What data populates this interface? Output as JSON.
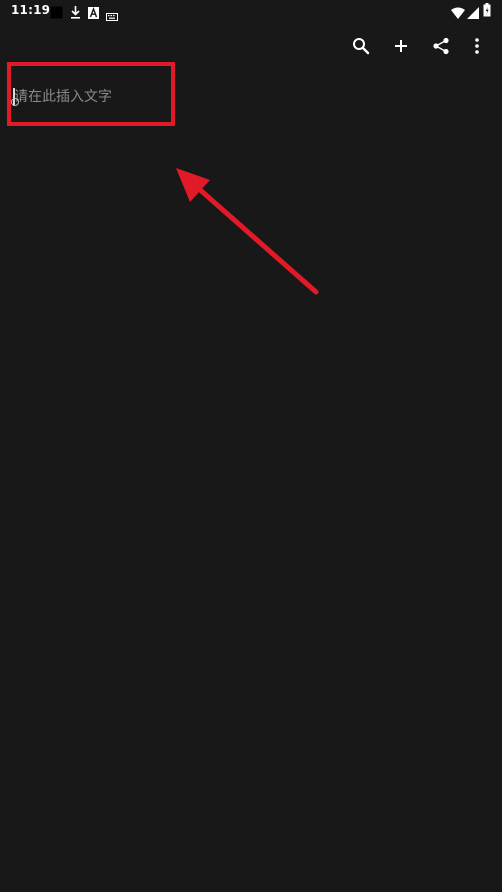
{
  "status_bar": {
    "time": "11:19",
    "notification_icons": [
      "app-icon",
      "download-icon",
      "a-box-icon",
      "keyboard-icon"
    ],
    "system_icons": [
      "wifi-icon",
      "signal-icon",
      "battery-icon"
    ]
  },
  "toolbar": {
    "icons": [
      "search-icon",
      "add-icon",
      "share-icon",
      "more-vert-icon"
    ]
  },
  "editor": {
    "value": "",
    "placeholder": "请在此插入文字"
  },
  "annotation": {
    "color": "#e21a27"
  },
  "colors": {
    "background": "#181818",
    "placeholder": "#8a8a8a"
  }
}
